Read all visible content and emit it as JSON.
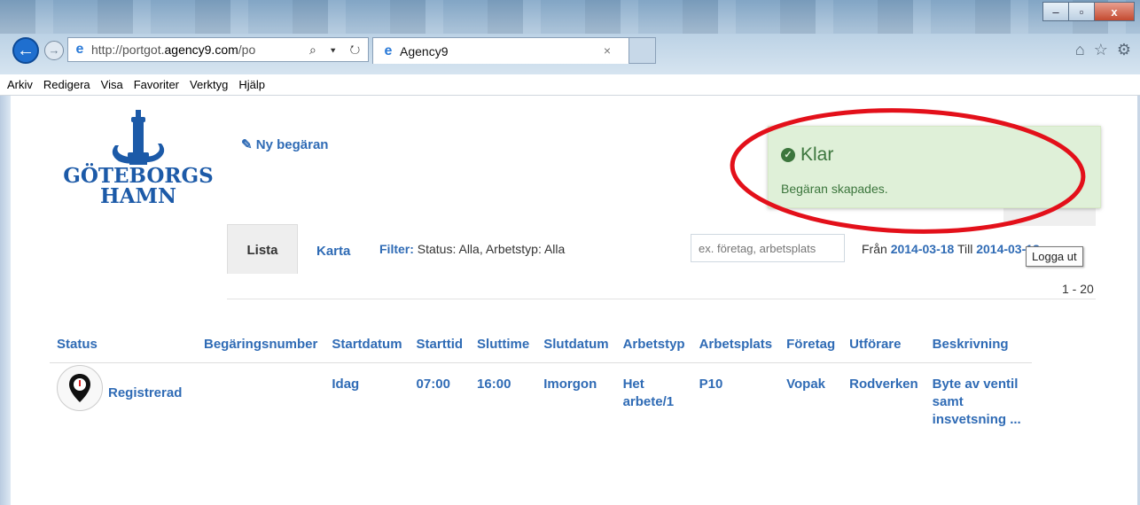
{
  "browser": {
    "address_prefix": "http://portgot.",
    "address_domain": "agency9.com",
    "address_suffix": "/po",
    "address_tools": "⌕ ▾ ↻",
    "tab_title": "Agency9",
    "tab_close": "×",
    "win_minimize": "–",
    "win_maximize": "▫",
    "win_close": "x",
    "home_icon": "⌂",
    "star_icon": "☆",
    "gear_icon": "⚙"
  },
  "menubar": [
    "Arkiv",
    "Redigera",
    "Visa",
    "Favoriter",
    "Verktyg",
    "Hjälp"
  ],
  "logo": {
    "line1": "GÖTEBORGS",
    "line2": "HAMN"
  },
  "actions": {
    "new_request": "Ny begäran",
    "new_request_icon": "✎"
  },
  "view_tabs": {
    "list": "Lista",
    "map": "Karta"
  },
  "filter": {
    "label": "Filter:",
    "text": "Status: Alla, Arbetstyp: Alla"
  },
  "search": {
    "placeholder": "ex. företag, arbetsplats"
  },
  "dates": {
    "from_label": "Från",
    "from": "2014-03-18",
    "to_label": "Till",
    "to": "2014-03-18"
  },
  "logout_tooltip": "Logga ut",
  "range": "1 - 20",
  "toast": {
    "title": "Klar",
    "message": "Begäran skapades.",
    "color": "#3c763d",
    "background": "#dff0d8"
  },
  "table": {
    "headers": [
      "Status",
      "Begäringsnumber",
      "Startdatum",
      "Starttid",
      "Sluttime",
      "Slutdatum",
      "Arbetstyp",
      "Arbetsplats",
      "Företag",
      "Utförare",
      "Beskrivning"
    ],
    "rows": [
      {
        "status": "Registrerad",
        "number": "",
        "start_date": "Idag",
        "start_time": "07:00",
        "end_time": "16:00",
        "end_date": "Imorgon",
        "work_type": "Het arbete/1",
        "work_place": "P10",
        "company": "Vopak",
        "executor": "Rodverken",
        "description": "Byte av ventil samt insvetsning ..."
      }
    ]
  },
  "colors": {
    "link": "#2f6bb5",
    "annotation": "#e3101a"
  }
}
